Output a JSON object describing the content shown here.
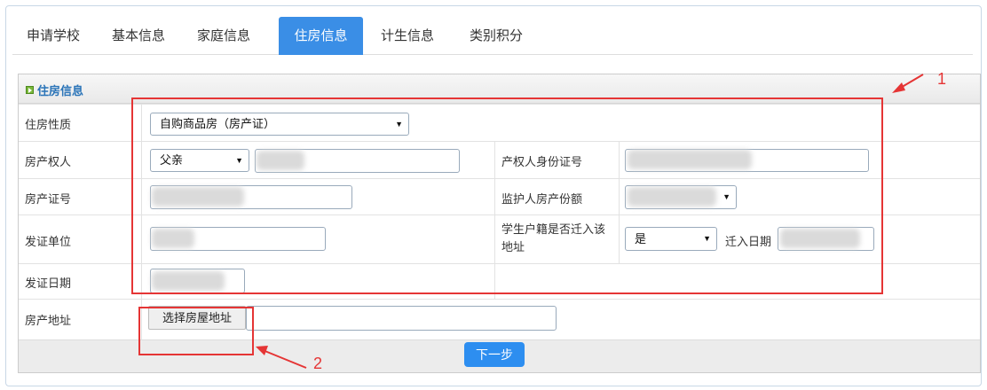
{
  "tabs": [
    {
      "label": "申请学校"
    },
    {
      "label": "基本信息"
    },
    {
      "label": "家庭信息"
    },
    {
      "label": "住房信息"
    },
    {
      "label": "计生信息"
    },
    {
      "label": "类别积分"
    }
  ],
  "active_tab": "住房信息",
  "section": {
    "title": "住房信息"
  },
  "form": {
    "housing_type": {
      "label": "住房性质",
      "value": "自购商品房（房产证）"
    },
    "owner": {
      "label": "房产权人",
      "value": "父亲"
    },
    "owner_id": {
      "label": "产权人身份证号"
    },
    "cert_no": {
      "label": "房产证号"
    },
    "guardian_share": {
      "label": "监护人房产份额"
    },
    "issuer": {
      "label": "发证单位"
    },
    "hukou_moved": {
      "label_line1": "学生户籍是否迁入该",
      "label_line2": "地址",
      "value": "是"
    },
    "move_in_date": {
      "label": "迁入日期"
    },
    "issue_date": {
      "label": "发证日期"
    },
    "address": {
      "label": "房产地址",
      "button": "选择房屋地址"
    }
  },
  "next_button": "下一步",
  "annotations": {
    "one": "1",
    "two": "2"
  },
  "colors": {
    "accent": "#3a8ee6",
    "highlight": "#e53535",
    "section_title": "#2a74b8"
  }
}
